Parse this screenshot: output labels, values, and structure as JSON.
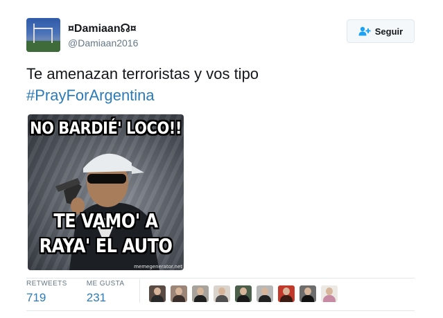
{
  "tweet": {
    "author": {
      "display_name": "¤Damiaan☊¤",
      "handle": "@Damiaan2016",
      "avatar_icon": "profile-avatar"
    },
    "follow_button": {
      "label": "Seguir",
      "icon": "add-user-icon"
    },
    "text": {
      "line1": "Te amenazan terroristas y vos tipo",
      "hashtag": "#PrayForArgentina"
    },
    "media": {
      "caption_top": "NO BARDIÉ' LOCO!!",
      "caption_bottom_1": "TE VAMO' A",
      "caption_bottom_2": "RAYA' EL AUTO",
      "watermark": "memegenerator.net"
    },
    "stats": {
      "retweets_label": "RETWEETS",
      "retweets_value": "719",
      "likes_label": "ME GUSTA",
      "likes_value": "231"
    },
    "likers": [
      {
        "name": "liker-avatar-1",
        "bg": "#5a4a44",
        "shirt": "#2a2a2a"
      },
      {
        "name": "liker-avatar-2",
        "bg": "#9a8578",
        "shirt": "#3a2f2b"
      },
      {
        "name": "liker-avatar-3",
        "bg": "#a7a29b",
        "shirt": "#1f1f1f"
      },
      {
        "name": "liker-avatar-4",
        "bg": "#d9d3cc",
        "shirt": "#505050"
      },
      {
        "name": "liker-avatar-5",
        "bg": "#4c5f4a",
        "shirt": "#1a1a1a"
      },
      {
        "name": "liker-avatar-6",
        "bg": "#b8b8b8",
        "shirt": "#222222"
      },
      {
        "name": "liker-avatar-7",
        "bg": "#c0392b",
        "shirt": "#3b1b12"
      },
      {
        "name": "liker-avatar-8",
        "bg": "#6d6d6d",
        "shirt": "#121212"
      },
      {
        "name": "liker-avatar-9",
        "bg": "#ece8e3",
        "shirt": "#c78aa3"
      }
    ],
    "colors": {
      "link": "#2b7bb9",
      "muted": "#657786",
      "border": "#e1e8ed"
    }
  }
}
